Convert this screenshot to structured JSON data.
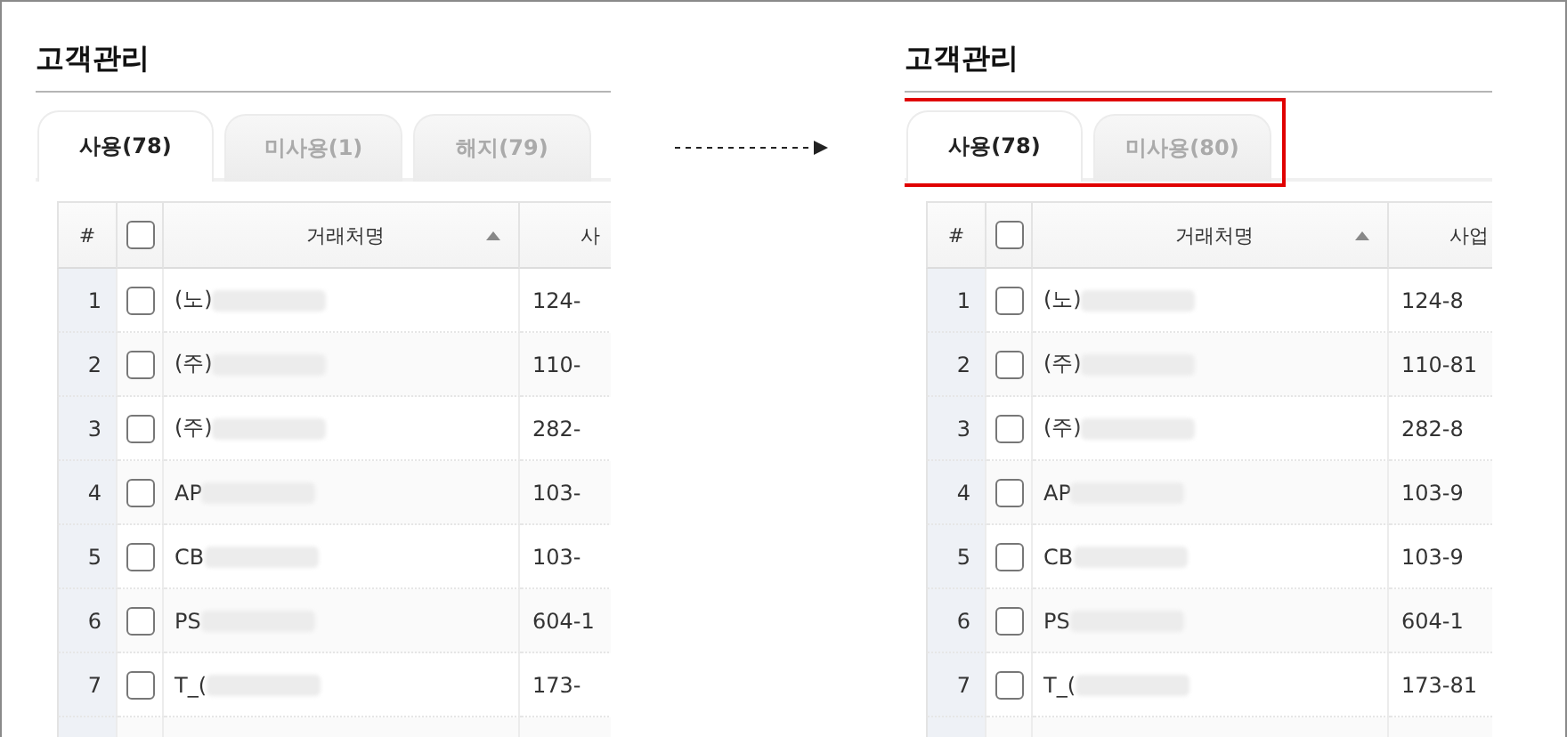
{
  "panels": [
    {
      "title": "고객관리",
      "tabs": [
        {
          "label": "사용(78)",
          "selected": true
        },
        {
          "label": "미사용(1)",
          "selected": false
        },
        {
          "label": "해지(79)",
          "selected": false
        }
      ],
      "columns": [
        "#",
        "거래처명",
        "사"
      ],
      "header_checked": false,
      "rows": [
        {
          "no": "1",
          "checked": false,
          "name": "(노)",
          "number": "124-"
        },
        {
          "no": "2",
          "checked": false,
          "name": "(주)",
          "number": "110-"
        },
        {
          "no": "3",
          "checked": false,
          "name": "(주)",
          "number": "282-"
        },
        {
          "no": "4",
          "checked": false,
          "name": "AP",
          "number": "103-"
        },
        {
          "no": "5",
          "checked": false,
          "name": "CB",
          "number": "103-"
        },
        {
          "no": "6",
          "checked": false,
          "name": "PS",
          "number": "604-1"
        },
        {
          "no": "7",
          "checked": false,
          "name": "T_(",
          "number": "173-"
        }
      ]
    },
    {
      "title": "고객관리",
      "highlight_tabs": true,
      "tabs": [
        {
          "label": "사용(78)",
          "selected": true
        },
        {
          "label": "미사용(80)",
          "selected": false
        }
      ],
      "columns": [
        "#",
        "거래처명",
        "사업"
      ],
      "header_checked": false,
      "rows": [
        {
          "no": "1",
          "checked": false,
          "name": "(노)",
          "number": "124-8"
        },
        {
          "no": "2",
          "checked": false,
          "name": "(주)",
          "number": "110-81"
        },
        {
          "no": "3",
          "checked": false,
          "name": "(주)",
          "number": "282-8"
        },
        {
          "no": "4",
          "checked": false,
          "name": "AP",
          "number": "103-9"
        },
        {
          "no": "5",
          "checked": false,
          "name": "CB",
          "number": "103-9"
        },
        {
          "no": "6",
          "checked": false,
          "name": "PS",
          "number": "604-1"
        },
        {
          "no": "7",
          "checked": false,
          "name": "T_(",
          "number": "173-81"
        }
      ]
    }
  ]
}
